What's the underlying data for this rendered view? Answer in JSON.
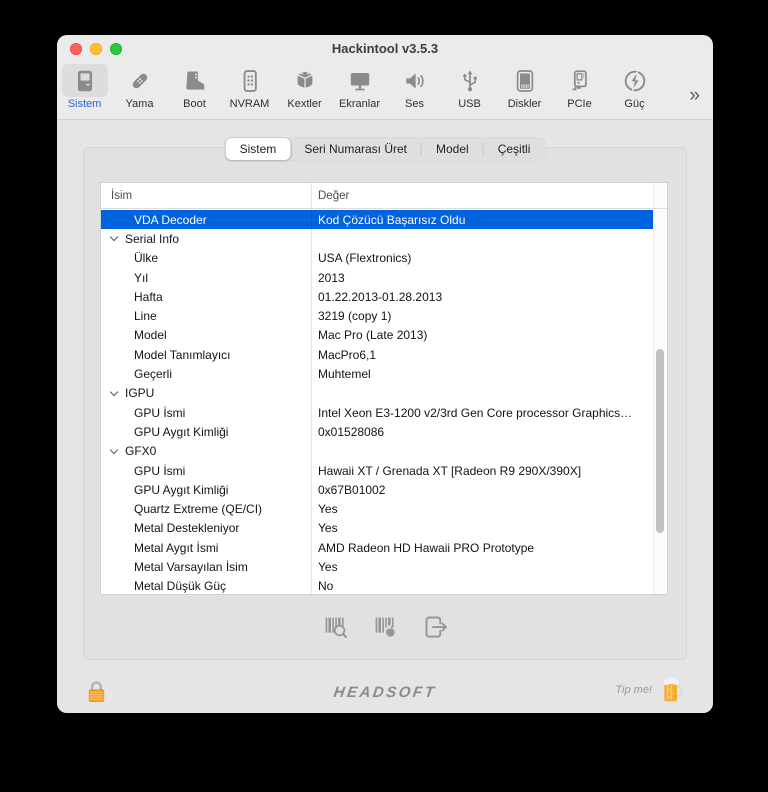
{
  "window": {
    "title": "Hackintool v3.5.3"
  },
  "toolbar": {
    "items": [
      {
        "label": "Sistem",
        "icon": "computer-icon",
        "selected": true
      },
      {
        "label": "Yama",
        "icon": "bandage-icon"
      },
      {
        "label": "Boot",
        "icon": "boot-icon"
      },
      {
        "label": "NVRAM",
        "icon": "memory-card-icon"
      },
      {
        "label": "Kextler",
        "icon": "kext-box-icon"
      },
      {
        "label": "Ekranlar",
        "icon": "display-icon"
      },
      {
        "label": "Ses",
        "icon": "speaker-icon"
      },
      {
        "label": "USB",
        "icon": "usb-icon"
      },
      {
        "label": "Diskler",
        "icon": "disk-icon"
      },
      {
        "label": "PCIe",
        "icon": "pcie-card-icon"
      },
      {
        "label": "Güç",
        "icon": "power-bolt-icon"
      }
    ],
    "more_label": "»"
  },
  "tabs": {
    "items": [
      {
        "label": "Sistem",
        "selected": true
      },
      {
        "label": "Seri Numarası Üret"
      },
      {
        "label": "Model"
      },
      {
        "label": "Çeşitli"
      }
    ]
  },
  "table": {
    "columns": {
      "name": "İsim",
      "value": "Değer"
    },
    "rows": [
      {
        "name": "VDA Decoder",
        "value": "Kod Çözücü Başarısız Oldu",
        "type": "child",
        "selected": true
      },
      {
        "name": "Serial Info",
        "value": "",
        "type": "group"
      },
      {
        "name": "Ülke",
        "value": "USA (Flextronics)",
        "type": "child"
      },
      {
        "name": "Yıl",
        "value": "2013",
        "type": "child"
      },
      {
        "name": "Hafta",
        "value": "01.22.2013-01.28.2013",
        "type": "child"
      },
      {
        "name": "Line",
        "value": "3219 (copy 1)",
        "type": "child"
      },
      {
        "name": "Model",
        "value": "Mac Pro (Late 2013)",
        "type": "child"
      },
      {
        "name": "Model Tanımlayıcı",
        "value": "MacPro6,1",
        "type": "child"
      },
      {
        "name": "Geçerli",
        "value": "Muhtemel",
        "type": "child"
      },
      {
        "name": "IGPU",
        "value": "",
        "type": "group"
      },
      {
        "name": "GPU İsmi",
        "value": "Intel Xeon E3-1200 v2/3rd Gen Core processor Graphics…",
        "type": "child"
      },
      {
        "name": "GPU Aygıt Kimliği",
        "value": "0x01528086",
        "type": "child"
      },
      {
        "name": "GFX0",
        "value": "",
        "type": "group"
      },
      {
        "name": "GPU İsmi",
        "value": "Hawaii XT / Grenada XT [Radeon R9 290X/390X]",
        "type": "child"
      },
      {
        "name": "GPU Aygıt Kimliği",
        "value": "0x67B01002",
        "type": "child"
      },
      {
        "name": "Quartz Extreme (QE/CI)",
        "value": "Yes",
        "type": "child"
      },
      {
        "name": "Metal Destekleniyor",
        "value": "Yes",
        "type": "child"
      },
      {
        "name": "Metal Aygıt İsmi",
        "value": "AMD Radeon HD Hawaii PRO Prototype",
        "type": "child"
      },
      {
        "name": "Metal Varsayılan İsim",
        "value": "Yes",
        "type": "child"
      },
      {
        "name": "Metal Düşük Güç",
        "value": "No",
        "type": "child"
      }
    ]
  },
  "actions": {
    "icons": [
      "serial-lookup-icon",
      "serial-generate-icon",
      "export-icon"
    ]
  },
  "footer": {
    "brand": "HEADSOFT",
    "tip_label": "Tip me!"
  },
  "colors": {
    "selection_blue": "#0062DF",
    "accent_label_blue": "#2566DD",
    "traffic_red": "#FF5F57",
    "traffic_yellow": "#FEBC2E",
    "traffic_green": "#28C840",
    "lock_orange": "#F29B2D",
    "beer_amber": "#F5AB2F",
    "icon_gray": "#8B8B8E"
  }
}
